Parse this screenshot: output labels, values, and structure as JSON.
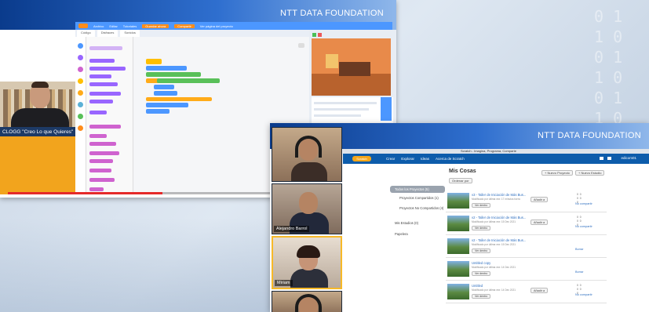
{
  "background": {
    "digits": "0 1\n1 0\n0 1\n1 0\n0 1\n1 0\n0 1\n1 0\n0 1\n1 0"
  },
  "top_panel": {
    "banner_title": "NTT DATA FOUNDATION",
    "scratch_menu": [
      "Archivo",
      "Editar",
      "Tutoriales",
      "Guardar ahora",
      "Compartir",
      "Ver página del proyecto"
    ],
    "scratch_tabs": [
      "Código",
      "Disfraces",
      "Sonidos"
    ],
    "presenter_label": "CLOGG \"Creo Lo que Quieres\"",
    "video_progress": 0.47
  },
  "meeting": {
    "banner_title": "NTT DATA FOUNDATION",
    "participants": [
      {
        "name": ""
      },
      {
        "name": "Alejandro Barrol"
      },
      {
        "name": "Miriam"
      },
      {
        "name": ""
      }
    ]
  },
  "scratch_site": {
    "browser_title": "Scratch - Imagina, Programa, Comparte",
    "logo": "Scratch",
    "nav": [
      "Crear",
      "Explorar",
      "Ideas",
      "Acerca de Scratch"
    ],
    "user": "edicom01",
    "page_title": "Mis Cosas",
    "new_project_btn": "+ Nuevo Proyecto",
    "new_studio_btn": "+ Nuevo Estudio",
    "sort_label": "Ordenar por",
    "sidebar": [
      {
        "label": "Todos los Proyectos (5)",
        "selected": true
      },
      {
        "label": "Proyectos Compartidos (1)",
        "selected": false
      },
      {
        "label": "Proyectos No Compartidos (4)",
        "selected": false
      },
      {
        "label": "Mis Estudios (0)",
        "selected": false
      },
      {
        "label": "Papelera",
        "selected": false
      }
    ],
    "projects": [
      {
        "title": "v3 - Taller de Iniciación de Más Bus...",
        "meta": "Modificado por última vez: 17 minutos fuera",
        "view": "Ver dentro",
        "add": "Añadir a",
        "stats": "0  0\n0  0\n0",
        "link": "No compartir"
      },
      {
        "title": "v2 - Taller de Iniciación de Más Bus...",
        "meta": "Modificado por última vez: 15 Dec 2021",
        "view": "Ver dentro",
        "add": "Añadir a",
        "stats": "0  0\n0  0\n0",
        "link": "No compartir"
      },
      {
        "title": "v2 - Taller de Iniciación de Más Bus...",
        "meta": "Modificado por última vez: 15 Dec 2021",
        "view": "Ver dentro",
        "add": "",
        "stats": "",
        "link": "Borrar"
      },
      {
        "title": "Untitled copy",
        "meta": "Modificado por última vez: 14 Dec 2021",
        "view": "Ver dentro",
        "add": "",
        "stats": "",
        "link": "Borrar"
      },
      {
        "title": "Untitled",
        "meta": "Modificado por última vez: 14 Dec 2021",
        "view": "Ver dentro",
        "add": "Añadir a",
        "stats": "0  0\n0  0\n0",
        "link": "No compartir"
      }
    ]
  }
}
